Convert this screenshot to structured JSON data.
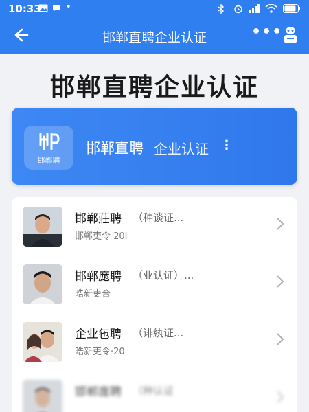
{
  "status_bar": {
    "time": "10:33",
    "icons": [
      "image-icon",
      "message-icon",
      "more-dots-icon",
      "bluetooth-icon",
      "alarm-icon",
      "signal-icon",
      "wifi-icon",
      "battery-icon"
    ]
  },
  "nav": {
    "title": "邯郸直聘企业认证",
    "more_label": "•••"
  },
  "headline": "邯郸直聘企业认证",
  "banner": {
    "logo_text": "邯郸聘",
    "title": "邯郸直聘",
    "subtitle": "企业认证",
    "dots": "⋮"
  },
  "list": [
    {
      "name": "邯郸莊聘",
      "tag": "（种谈证...",
      "meta": "邯郸吏令 20I"
    },
    {
      "name": "邯郸庬聘",
      "tag": "（业认证）...",
      "meta": "晧新吏合"
    },
    {
      "name": "企业㐌聘",
      "tag": "（诽紈证...",
      "meta": "晧新吏令·20"
    },
    {
      "name": "邯郸庬聘",
      "tag": "（种认证",
      "meta": ""
    }
  ],
  "colors": {
    "primary": "#2f7ff0",
    "banner": "#3d88f4",
    "background": "#f1f2f5"
  }
}
